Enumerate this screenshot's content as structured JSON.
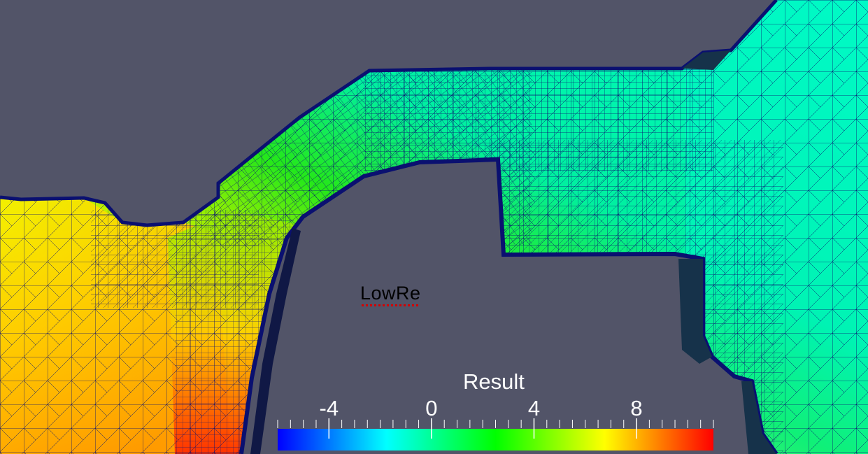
{
  "annotation": {
    "text": "LowRe"
  },
  "colorbar": {
    "title": "Result",
    "range": [
      -6,
      11
    ],
    "tick_labels": [
      "-4",
      "0",
      "4",
      "8"
    ],
    "tick_values": [
      -4,
      0,
      4,
      8
    ],
    "colors": [
      "#0000ff",
      "#00ffff",
      "#00ff00",
      "#ffff00",
      "#ff0000"
    ]
  },
  "colors": {
    "background": "#525468",
    "mesh_edges": "#0a1070",
    "annotation_text": "#000000",
    "legend_text": "#ffffff"
  }
}
